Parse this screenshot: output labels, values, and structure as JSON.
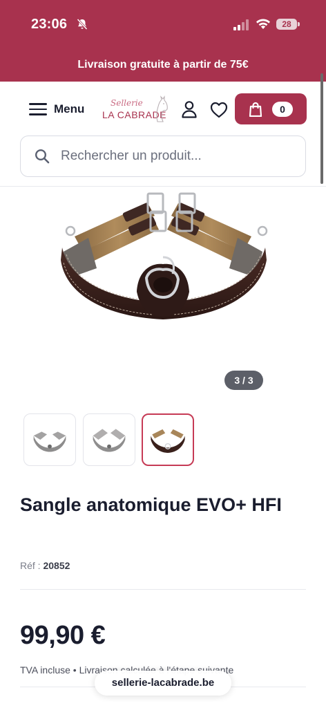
{
  "status_bar": {
    "time": "23:06",
    "battery": "28",
    "icons": [
      "bell-slash-icon",
      "signal-icon",
      "wifi-icon",
      "battery-icon"
    ]
  },
  "promo": {
    "text": "Livraison gratuite à partir de 75€"
  },
  "header": {
    "menu_label": "Menu",
    "logo_script": "Sellerie",
    "logo_name": "LA CABRADE",
    "cart_count": "0",
    "icons": [
      "hamburger-icon",
      "user-icon",
      "heart-icon",
      "shopping-bag-icon"
    ]
  },
  "search": {
    "placeholder": "Rechercher un produit..."
  },
  "gallery": {
    "counter": "3 / 3",
    "active_index": 3,
    "thumbnail_count": 3
  },
  "product": {
    "title": "Sangle anatomique EVO+ HFI",
    "ref_label": "Réf :",
    "ref_value": "20852",
    "price": "99,90 €",
    "tax_note": "TVA incluse • Livraison calculée à l'étape suivante"
  },
  "browser": {
    "url": "sellerie-lacabrade.be"
  },
  "colors": {
    "brand": "#a8324e",
    "accent_border": "#c63a55",
    "text_dark": "#1a1d2e"
  }
}
